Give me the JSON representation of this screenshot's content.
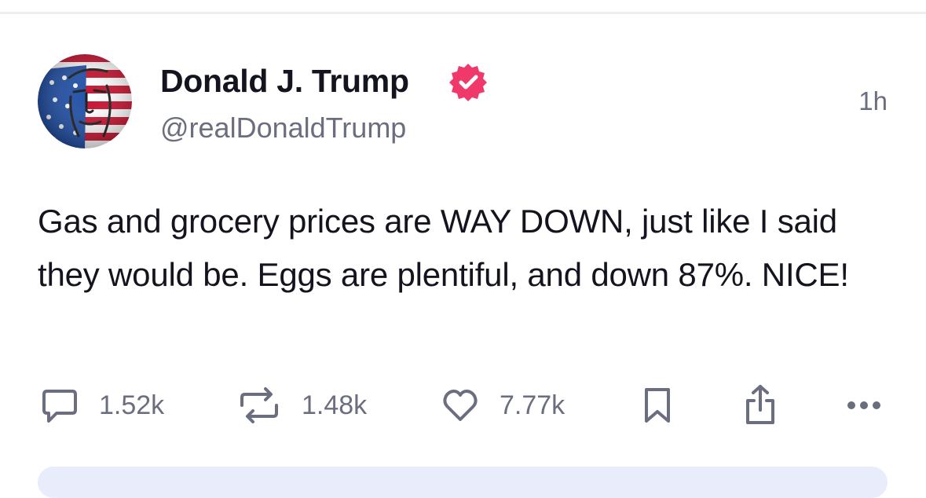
{
  "post": {
    "author": {
      "display_name": "Donald J. Trump",
      "handle": "@realDonaldTrump",
      "verified": true,
      "verified_color": "#f0386b"
    },
    "timestamp": "1h",
    "text": "Gas and grocery prices are WAY DOWN, just like I said they would be. Eggs are plentiful, and down 87%. NICE!"
  },
  "actions": {
    "replies": "1.52k",
    "reposts": "1.48k",
    "likes": "7.77k",
    "icons": [
      "comment-icon",
      "repost-icon",
      "heart-icon",
      "bookmark-icon",
      "share-icon",
      "more-icon"
    ]
  },
  "colors": {
    "text_primary": "#14141f",
    "text_secondary": "#6b6e7e",
    "compose_bar": "#e9ecfb"
  }
}
